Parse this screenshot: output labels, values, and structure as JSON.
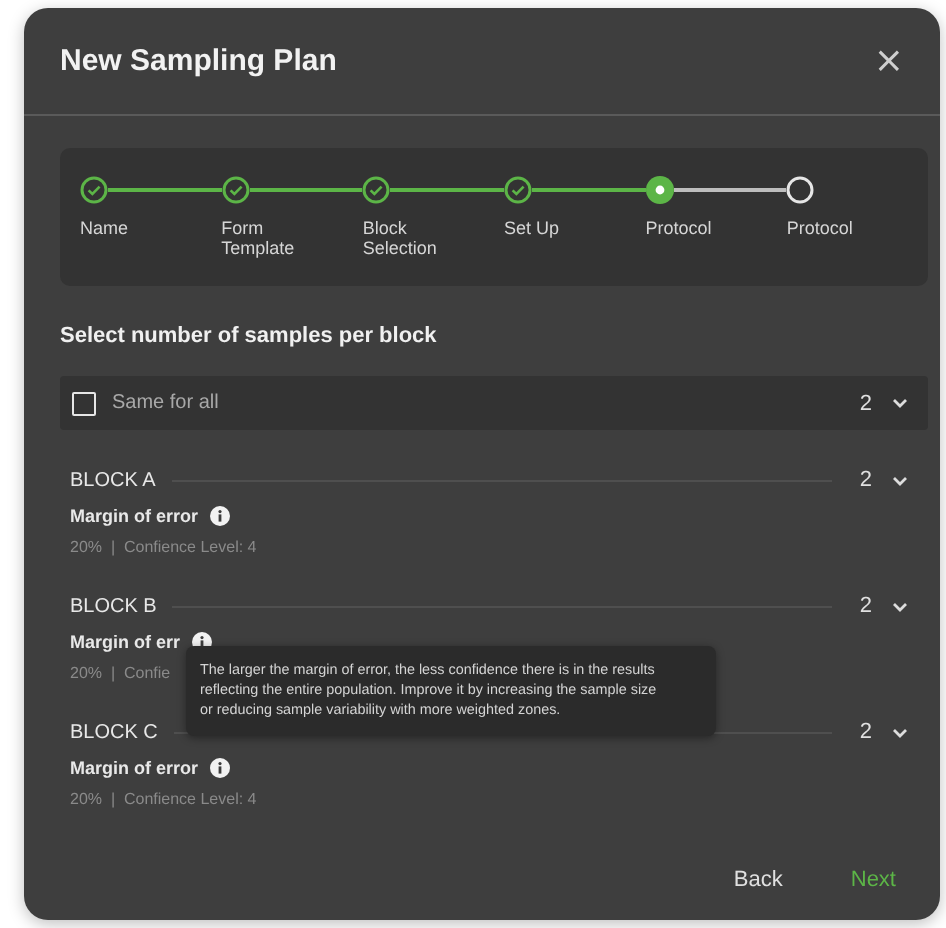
{
  "dialog": {
    "title": "New Sampling Plan",
    "close": "×"
  },
  "steps": [
    {
      "label": "Name",
      "done": true,
      "current": false
    },
    {
      "label": "Form Template",
      "done": true,
      "current": false
    },
    {
      "label": "Block Selection",
      "done": true,
      "current": false
    },
    {
      "label": "Set Up",
      "done": true,
      "current": false
    },
    {
      "label": "Protocol",
      "done": false,
      "current": true
    },
    {
      "label": "Protocol",
      "done": false,
      "current": false
    }
  ],
  "section_title": "Select number of samples per block",
  "same_for_all": {
    "label": "Same for all",
    "checked": false,
    "value": "2"
  },
  "blocks": [
    {
      "name": "BLOCK A",
      "value": "2",
      "margin_label": "Margin of error",
      "info": "20%  |  Confience Level: 4"
    },
    {
      "name": "BLOCK B",
      "value": "2",
      "margin_label": "Margin of err",
      "info": "20%  |  Confie"
    },
    {
      "name": "BLOCK C",
      "value": "2",
      "margin_label": "Margin of error",
      "info": "20%  |  Confience Level: 4"
    }
  ],
  "tooltip": "The larger the margin of error, the less confidence there is in the results reflecting the entire population. Improve it by increasing the sample size or reducing sample variability with more weighted zones.",
  "buttons": [
    {
      "label": "Back",
      "kind": "secondary"
    },
    {
      "label": "Next",
      "kind": "primary"
    }
  ]
}
